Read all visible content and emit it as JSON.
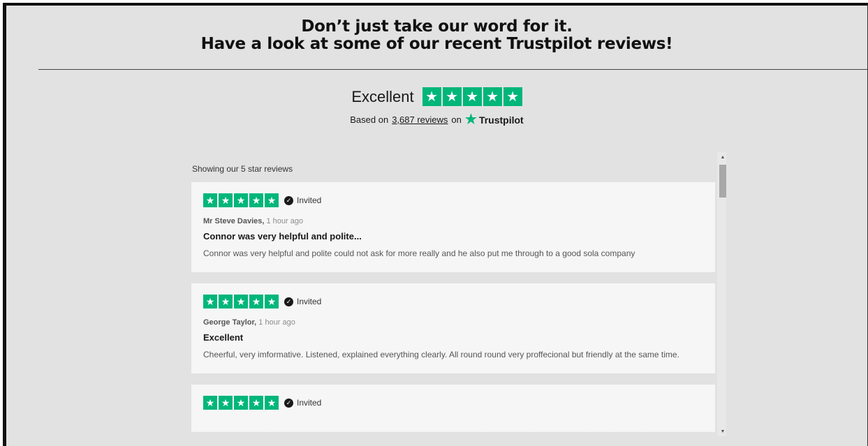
{
  "header": {
    "line1": "Don’t just take our word for it.",
    "line2": "Have a look at some of our recent Trustpilot reviews!"
  },
  "summary": {
    "rating_word": "Excellent",
    "stars": 5,
    "based_prefix": "Based on",
    "review_count_link": "3,687 reviews",
    "based_on": "on",
    "brand": "Trustpilot"
  },
  "widget": {
    "showing_label": "Showing our 5 star reviews",
    "reviews": [
      {
        "stars": 5,
        "invited_label": "Invited",
        "author": "Mr Steve Davies,",
        "time": "1 hour ago",
        "title": "Connor was very helpful and polite...",
        "body": "Connor was very helpful and polite could not ask for more really and he also put me through to a good sola company"
      },
      {
        "stars": 5,
        "invited_label": "Invited",
        "author": "George Taylor,",
        "time": "1 hour ago",
        "title": "Excellent",
        "body": "Cheerful, very imformative. Listened, explained everything clearly. All round round very proffecional but friendly at the same time."
      },
      {
        "stars": 5,
        "invited_label": "Invited",
        "author": "",
        "time": "",
        "title": "",
        "body": ""
      }
    ]
  },
  "colors": {
    "trustpilot_green": "#00b67a",
    "page_background": "#e2e2e2",
    "card_background": "#f6f6f6"
  },
  "icons": {
    "star": "star-icon",
    "verified": "check-circle-icon",
    "scroll_up": "chevron-up-icon",
    "scroll_down": "chevron-down-icon"
  }
}
